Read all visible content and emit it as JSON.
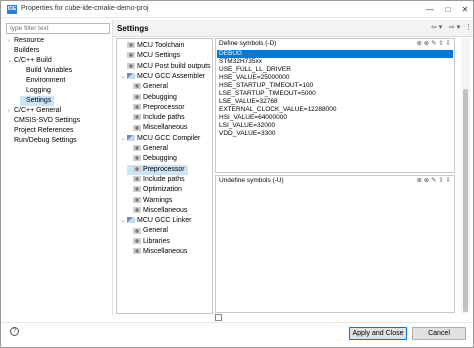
{
  "window": {
    "app_icon": "IDE",
    "title": "Properties for cube-ide-cmake-demo-proj",
    "min": "—",
    "max": "□",
    "close": "✕"
  },
  "filter": {
    "placeholder": "type filter text"
  },
  "nav": {
    "items": [
      {
        "label": "Resource",
        "twisty": "›"
      },
      {
        "label": "Builders",
        "twisty": ""
      },
      {
        "label": "C/C++ Build",
        "twisty": "⌄"
      },
      {
        "label": "Build Variables",
        "twisty": ""
      },
      {
        "label": "Environment",
        "twisty": ""
      },
      {
        "label": "Logging",
        "twisty": ""
      },
      {
        "label": "Settings",
        "twisty": ""
      },
      {
        "label": "C/C++ General",
        "twisty": "›"
      },
      {
        "label": "CMSIS-SVD Settings",
        "twisty": ""
      },
      {
        "label": "Project References",
        "twisty": ""
      },
      {
        "label": "Run/Debug Settings",
        "twisty": ""
      }
    ]
  },
  "header": {
    "title": "Settings"
  },
  "tool_tree": {
    "items": [
      {
        "label": "MCU Toolchain",
        "twisty": ""
      },
      {
        "label": "MCU Settings",
        "twisty": ""
      },
      {
        "label": "MCU Post build outputs",
        "twisty": ""
      },
      {
        "label": "MCU GCC Assembler",
        "twisty": "⌄"
      },
      {
        "label": "General",
        "twisty": ""
      },
      {
        "label": "Debugging",
        "twisty": ""
      },
      {
        "label": "Preprocessor",
        "twisty": ""
      },
      {
        "label": "Include paths",
        "twisty": ""
      },
      {
        "label": "Miscellaneous",
        "twisty": ""
      },
      {
        "label": "MCU GCC Compiler",
        "twisty": "⌄"
      },
      {
        "label": "General",
        "twisty": ""
      },
      {
        "label": "Debugging",
        "twisty": ""
      },
      {
        "label": "Preprocessor",
        "twisty": ""
      },
      {
        "label": "Include paths",
        "twisty": ""
      },
      {
        "label": "Optimization",
        "twisty": ""
      },
      {
        "label": "Warnings",
        "twisty": ""
      },
      {
        "label": "Miscellaneous",
        "twisty": ""
      },
      {
        "label": "MCU GCC Linker",
        "twisty": "⌄"
      },
      {
        "label": "General",
        "twisty": ""
      },
      {
        "label": "Libraries",
        "twisty": ""
      },
      {
        "label": "Miscellaneous",
        "twisty": ""
      }
    ]
  },
  "define_panel": {
    "title": "Define symbols (-D)",
    "tools": "⊕ ⊗ ✎ ⇧ ⇩",
    "items": [
      "DEBUG",
      "STM32H735xx",
      "USE_FULL_LL_DRIVER",
      "HSE_VALUE=25000000",
      "HSE_STARTUP_TIMEOUT=100",
      "LSE_STARTUP_TIMEOUT=5000",
      "LSE_VALUE=32768",
      "EXTERNAL_CLOCK_VALUE=12288000",
      "HSI_VALUE=64000000",
      "LSI_VALUE=32000",
      "VDD_VALUE=3300"
    ]
  },
  "undefine_panel": {
    "title": "Undefine symbols (-U)",
    "tools": "⊕ ⊗ ✎ ⇧ ⇩"
  },
  "buttons": {
    "help": "?",
    "apply_close": "Apply and Close",
    "cancel": "Cancel"
  },
  "colors": {
    "selection": "#0078d7",
    "tree_selection": "#cce4f7"
  }
}
